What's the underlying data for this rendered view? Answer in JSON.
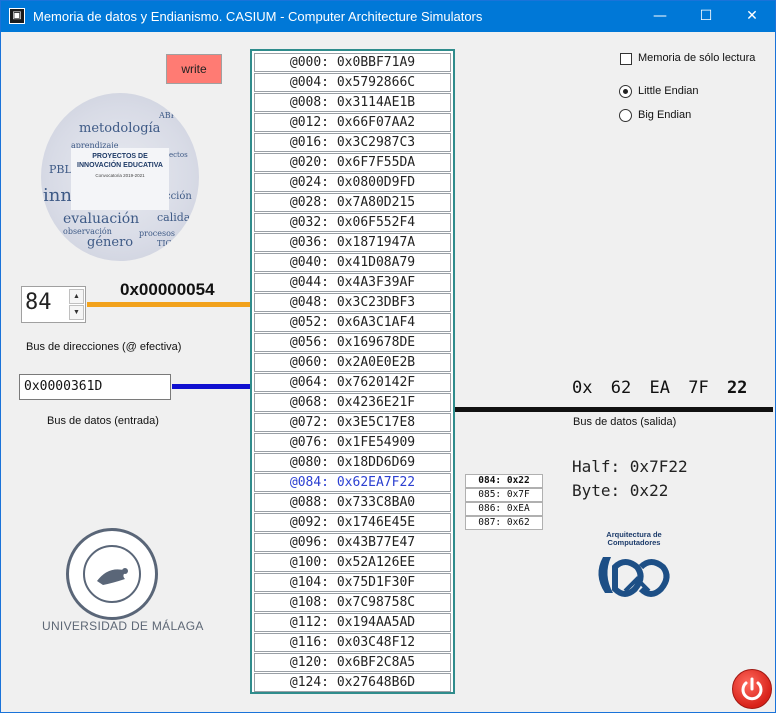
{
  "window": {
    "title": "Memoria de datos y Endianismo. CASIUM - Computer Architecture Simulators",
    "minimize": "—",
    "maximize": "☐",
    "close": "✕"
  },
  "controls": {
    "write_label": "write",
    "readonly_label": "Memoria de sólo lectura",
    "readonly_checked": false,
    "endian_options": [
      "Little Endian",
      "Big Endian"
    ],
    "endian_selected": "Little Endian"
  },
  "logo": {
    "innovation_title": "PROYECTOS DE INNOVACIÓN EDUCATIVA",
    "innovation_call": "Convocatoria 2019-2021",
    "innovation_words": [
      "metodología",
      "ABP",
      "innovación",
      "evaluación",
      "aprendizaje",
      "PBL",
      "acción",
      "género",
      "calidad",
      "TIC",
      "procesos",
      "observación",
      "proyectos"
    ],
    "university": "UNIVERSIDAD DE MÁLAGA",
    "arq_title": "Arquitectura de Computadores"
  },
  "address_bus": {
    "value": "84",
    "hex": "0x00000054",
    "label": "Bus de direcciones (@ efectiva)",
    "color": "#f2a21c"
  },
  "data_in": {
    "value": "0x0000361D",
    "label": "Bus de datos (entrada)",
    "color": "#1010d0"
  },
  "data_out": {
    "prefix": "0x",
    "bytes": [
      "62",
      "EA",
      "7F"
    ],
    "last_byte": "22",
    "label": "Bus de datos (salida)",
    "half": "Half: 0x7F22",
    "byte": "Byte: 0x22"
  },
  "memory": [
    {
      "addr": "@000:",
      "value": "0x0BBF71A9"
    },
    {
      "addr": "@004:",
      "value": "0x5792866C"
    },
    {
      "addr": "@008:",
      "value": "0x3114AE1B"
    },
    {
      "addr": "@012:",
      "value": "0x66F07AA2"
    },
    {
      "addr": "@016:",
      "value": "0x3C2987C3"
    },
    {
      "addr": "@020:",
      "value": "0x6F7F55DA"
    },
    {
      "addr": "@024:",
      "value": "0x0800D9FD"
    },
    {
      "addr": "@028:",
      "value": "0x7A80D215"
    },
    {
      "addr": "@032:",
      "value": "0x06F552F4"
    },
    {
      "addr": "@036:",
      "value": "0x1871947A"
    },
    {
      "addr": "@040:",
      "value": "0x41D08A79"
    },
    {
      "addr": "@044:",
      "value": "0x4A3F39AF"
    },
    {
      "addr": "@048:",
      "value": "0x3C23DBF3"
    },
    {
      "addr": "@052:",
      "value": "0x6A3C1AF4"
    },
    {
      "addr": "@056:",
      "value": "0x169678DE"
    },
    {
      "addr": "@060:",
      "value": "0x2A0E0E2B"
    },
    {
      "addr": "@064:",
      "value": "0x7620142F"
    },
    {
      "addr": "@068:",
      "value": "0x4236E21F"
    },
    {
      "addr": "@072:",
      "value": "0x3E5C17E8"
    },
    {
      "addr": "@076:",
      "value": "0x1FE54909"
    },
    {
      "addr": "@080:",
      "value": "0x18DD6D69"
    },
    {
      "addr": "@084:",
      "value": "0x62EA7F22",
      "highlight": true
    },
    {
      "addr": "@088:",
      "value": "0x733C8BA0"
    },
    {
      "addr": "@092:",
      "value": "0x1746E45E"
    },
    {
      "addr": "@096:",
      "value": "0x43B77E47"
    },
    {
      "addr": "@100:",
      "value": "0x52A126EE"
    },
    {
      "addr": "@104:",
      "value": "0x75D1F30F"
    },
    {
      "addr": "@108:",
      "value": "0x7C98758C"
    },
    {
      "addr": "@112:",
      "value": "0x194AA5AD"
    },
    {
      "addr": "@116:",
      "value": "0x03C48F12"
    },
    {
      "addr": "@120:",
      "value": "0x6BF2C8A5"
    },
    {
      "addr": "@124:",
      "value": "0x27648B6D"
    }
  ],
  "byte_breakdown": [
    {
      "text": "084: 0x22"
    },
    {
      "text": "085: 0x7F"
    },
    {
      "text": "086: 0xEA"
    },
    {
      "text": "087: 0x62"
    }
  ]
}
